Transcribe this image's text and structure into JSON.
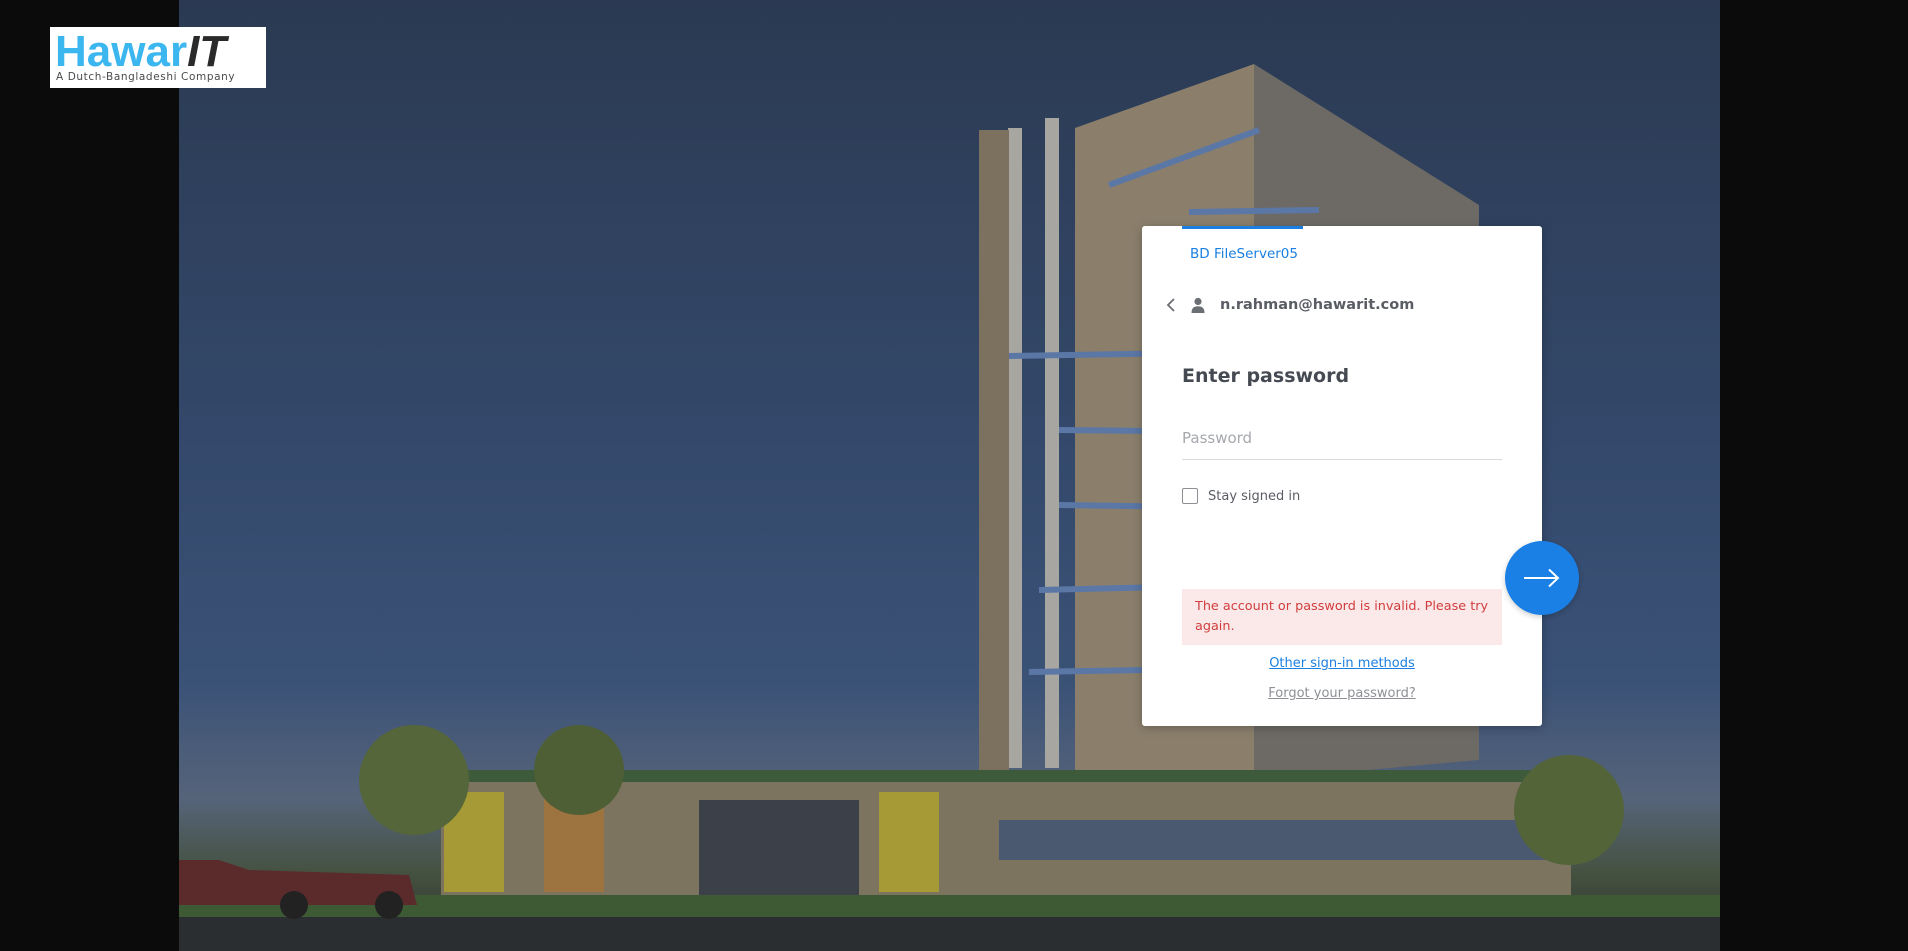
{
  "logo": {
    "word_primary": "Hawar",
    "word_accent": "IT",
    "tagline": "A Dutch-Bangladeshi Company"
  },
  "login": {
    "server_name": "BD FileServer05",
    "account_email": "n.rahman@hawarit.com",
    "heading": "Enter password",
    "password_placeholder": "Password",
    "password_value": "",
    "stay_signed_in_label": "Stay signed in",
    "stay_signed_in_checked": false,
    "error_message": "The account or password is invalid. Please try again.",
    "other_methods_label": "Other sign-in methods",
    "forgot_password_label": "Forgot your password?"
  },
  "icons": {
    "back": "chevron-left-icon",
    "user": "user-icon",
    "next": "arrow-right-icon"
  },
  "colors": {
    "accent": "#1a80e6",
    "logo_blue": "#3bb6ee",
    "error_text": "#d13d3d",
    "error_bg": "#fbe9e9"
  }
}
